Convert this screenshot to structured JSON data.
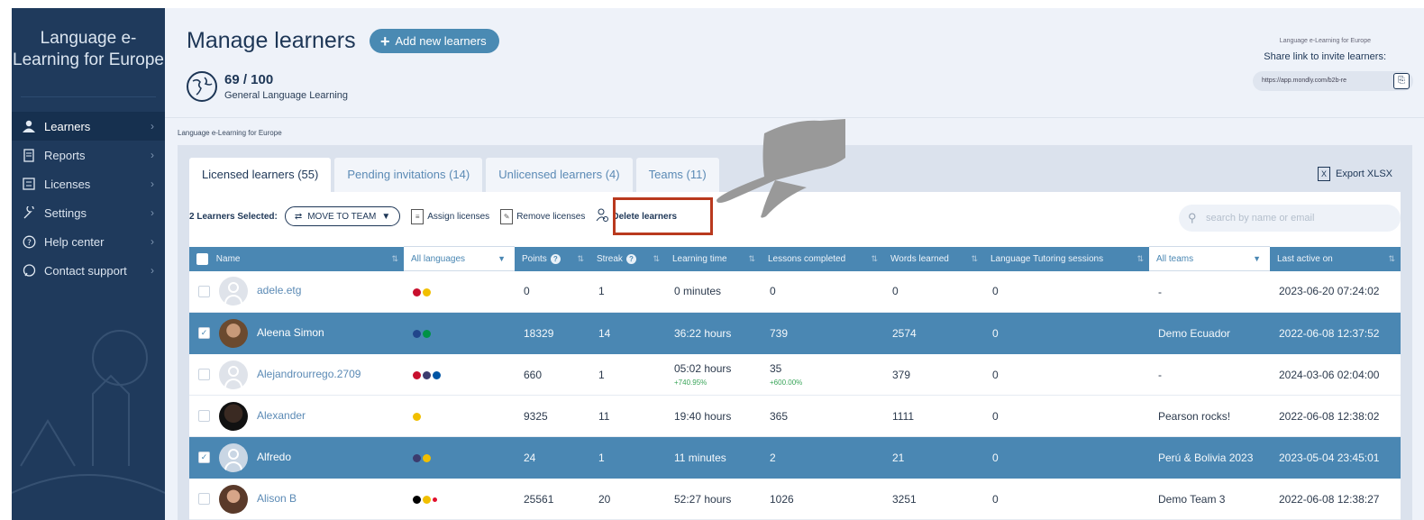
{
  "sidebar": {
    "brand": "Language e-Learning for Europe",
    "items": [
      {
        "label": "Learners",
        "icon": "person-icon",
        "active": true
      },
      {
        "label": "Reports",
        "icon": "report-icon"
      },
      {
        "label": "Licenses",
        "icon": "license-icon"
      },
      {
        "label": "Settings",
        "icon": "wrench-icon"
      },
      {
        "label": "Help center",
        "icon": "help-icon"
      },
      {
        "label": "Contact support",
        "icon": "chat-icon"
      }
    ]
  },
  "header": {
    "title": "Manage learners",
    "add_label": "Add new learners",
    "count": "69 / 100",
    "count_sub": "General Language Learning",
    "share_org": "Language e-Learning for Europe",
    "share_label": "Share link to invite learners:",
    "share_link": "https://app.mondly.com/b2b-re"
  },
  "breadcrumb": "Language e-Learning for Europe",
  "tabs": [
    "Licensed learners (55)",
    "Pending invitations (14)",
    "Unlicensed learners (4)",
    "Teams (11)"
  ],
  "export_label": "Export XLSX",
  "actions": {
    "selected": "2 Learners Selected:",
    "move": "MOVE TO TEAM",
    "assign": "Assign licenses",
    "remove": "Remove licenses",
    "delete": "Delete learners"
  },
  "search_placeholder": "search by name or email",
  "columns": {
    "name": "Name",
    "languages": "All languages",
    "points": "Points",
    "streak": "Streak",
    "learning_time": "Learning time",
    "lessons": "Lessons completed",
    "words": "Words learned",
    "tutoring": "Language Tutoring sessions",
    "teams": "All teams",
    "last_active": "Last active on"
  },
  "rows": [
    {
      "name": "adele.etg",
      "flags": [
        "#c8102e",
        "#f1bf00"
      ],
      "points": "0",
      "streak": "1",
      "time": "0 minutes",
      "lessons": "0",
      "words": "0",
      "tutoring": "0",
      "team": "-",
      "last": "2023-06-20 07:24:02"
    },
    {
      "name": "Aleena Simon",
      "flags": [
        "#21468b",
        "#009246"
      ],
      "points": "18329",
      "streak": "14",
      "time": "36:22 hours",
      "lessons": "739",
      "words": "2574",
      "tutoring": "0",
      "team": "Demo Ecuador",
      "last": "2022-06-08 12:37:52"
    },
    {
      "name": "Alejandrourrego.2709",
      "flags": [
        "#c8102e",
        "#3c3b6e",
        "#0055a4"
      ],
      "points": "660",
      "streak": "1",
      "time": "05:02 hours",
      "time_sub": "+740.95%",
      "lessons": "35",
      "lessons_sub": "+600.00%",
      "words": "379",
      "tutoring": "0",
      "team": "-",
      "last": "2024-03-06 02:04:00"
    },
    {
      "name": "Alexander",
      "flags": [
        "#f1bf00"
      ],
      "points": "9325",
      "streak": "11",
      "time": "19:40 hours",
      "lessons": "365",
      "words": "1111",
      "tutoring": "0",
      "team": "Pearson rocks!",
      "last": "2022-06-08 12:38:02"
    },
    {
      "name": "Alfredo",
      "flags": [
        "#3c3b6e",
        "#f1bf00"
      ],
      "points": "24",
      "streak": "1",
      "time": "11 minutes",
      "lessons": "2",
      "words": "21",
      "tutoring": "0",
      "team": "Perú & Bolivia 2023",
      "last": "2023-05-04 23:45:01"
    },
    {
      "name": "Alison B",
      "flags": [
        "#000000",
        "#f1bf00",
        "#e0102e"
      ],
      "points": "25561",
      "streak": "20",
      "time": "52:27 hours",
      "lessons": "1026",
      "words": "3251",
      "tutoring": "0",
      "team": "Demo Team 3",
      "last": "2022-06-08 12:38:27"
    }
  ]
}
